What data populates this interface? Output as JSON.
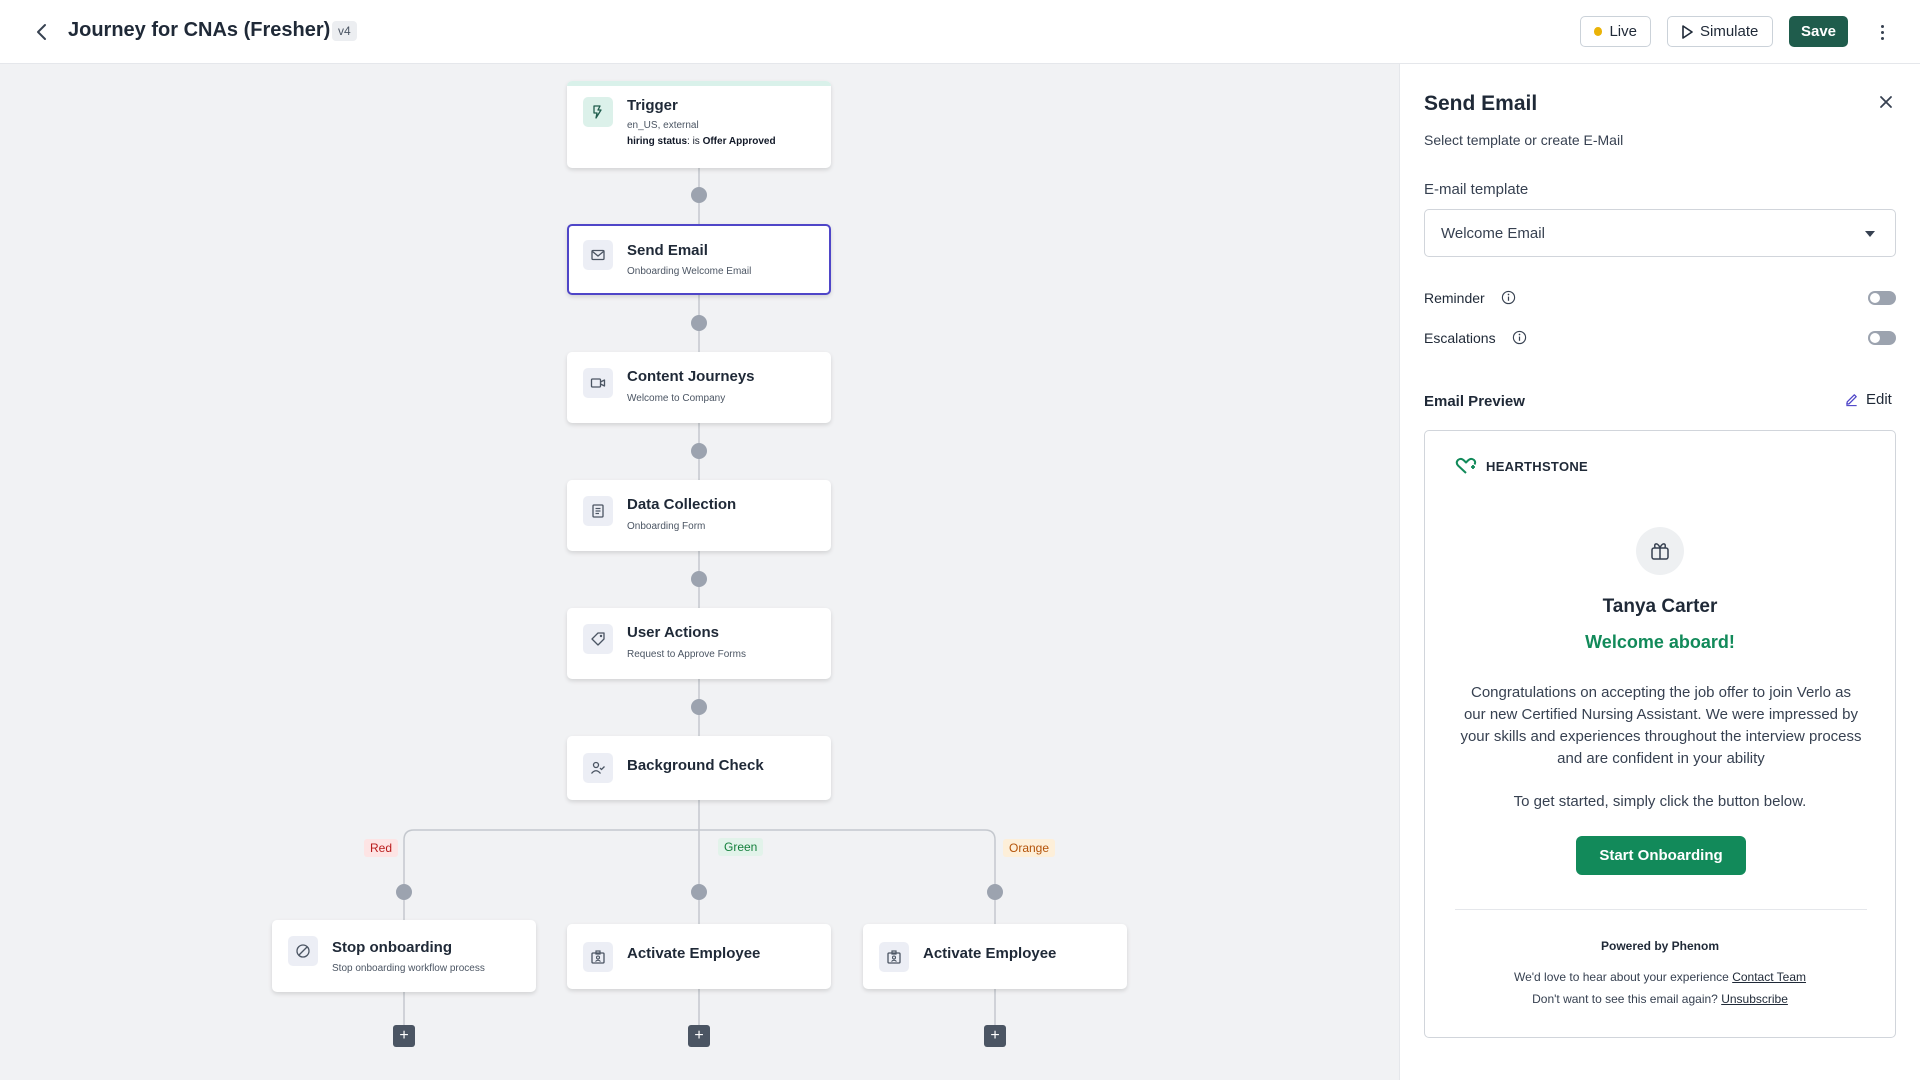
{
  "header": {
    "title": "Journey for CNAs (Fresher)",
    "version": "v4",
    "live_label": "Live",
    "simulate_label": "Simulate",
    "save_label": "Save"
  },
  "canvas": {
    "nodes": [
      {
        "title": "Trigger",
        "sub": "en_US, external",
        "condition_key": "hiring status",
        "condition_op": ": is ",
        "condition_value": "Offer Approved",
        "icon": "trigger-icon"
      },
      {
        "title": "Send Email",
        "sub": "Onboarding Welcome Email",
        "icon": "mail-icon",
        "selected": true
      },
      {
        "title": "Content Journeys",
        "sub": "Welcome to Company",
        "icon": "video-icon"
      },
      {
        "title": "Data Collection",
        "sub": "Onboarding Form",
        "icon": "form-icon"
      },
      {
        "title": "User Actions",
        "sub": "Request to Approve Forms",
        "icon": "tag-icon"
      },
      {
        "title": "Background Check",
        "icon": "user-check-icon"
      },
      {
        "title": "Stop onboarding",
        "sub": "Stop onboarding workflow process",
        "icon": "stop-icon"
      },
      {
        "title": "Activate Employee",
        "icon": "badge-icon"
      },
      {
        "title": "Activate Employee",
        "icon": "badge-icon"
      }
    ],
    "branches": [
      {
        "label": "Red",
        "color": "#b91c1c"
      },
      {
        "label": "Green",
        "color": "#15803d"
      },
      {
        "label": "Orange",
        "color": "#b45309"
      }
    ],
    "add_symbol": "+"
  },
  "panel": {
    "title": "Send Email",
    "subtitle": "Select template or create E-Mail",
    "template_label": "E-mail template",
    "template_value": "Welcome Email",
    "reminder_label": "Reminder",
    "reminder_on": false,
    "escalations_label": "Escalations",
    "escalations_on": false,
    "preview_label": "Email Preview",
    "edit_label": "Edit",
    "email": {
      "brand": "HEARTHSTONE",
      "name": "Tanya Carter",
      "greeting": "Welcome aboard!",
      "body": "Congratulations on accepting the job offer to join Verlo as our new Certified Nursing Assistant. We were impressed by your skills and experiences throughout the interview process and are confident in your ability",
      "body2": "To get started, simply click the button below.",
      "cta": "Start Onboarding",
      "powered": "Powered by Phenom",
      "footer1_text": "We'd love to hear about your experience",
      "footer1_link": "Contact Team",
      "footer2_text": "Don't want to see this email again?",
      "footer2_link": "Unsubscribe"
    }
  },
  "colors": {
    "accent": "#1f5c4c",
    "selected_border": "#4f46c8",
    "cta_green": "#128a5a",
    "live_dot": "#eab308"
  }
}
